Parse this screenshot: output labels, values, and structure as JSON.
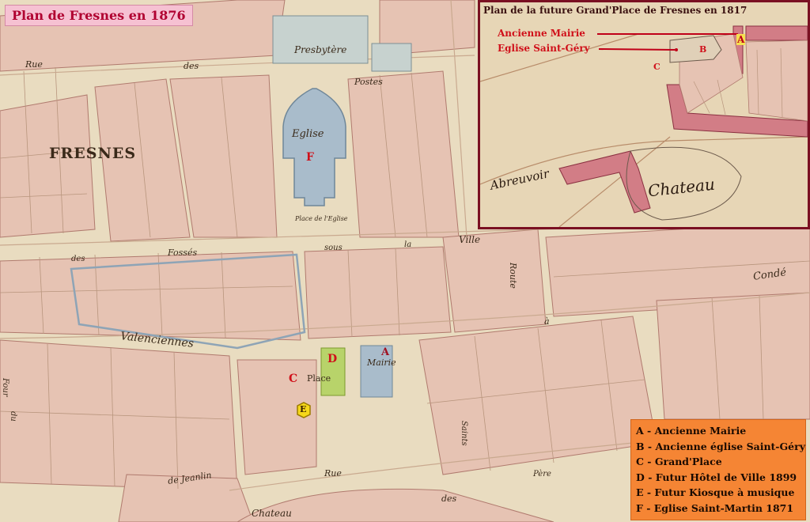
{
  "title": "Plan de Fresnes en 1876",
  "inset": {
    "title": "Plan de la future Grand'Place de Fresnes en 1817",
    "callouts": [
      {
        "text": "Ancienne Mairie",
        "marker": "A"
      },
      {
        "text": "Eglise Saint-Géry",
        "marker": "B"
      }
    ],
    "marker_c": "C",
    "labels": {
      "abreuvoir": "Abreuvoir",
      "chateau": "Chateau"
    }
  },
  "markers": {
    "a": "A",
    "c": "C",
    "d": "D",
    "e": "E",
    "f": "F"
  },
  "map_labels": {
    "fresnes": "FRESNES",
    "presbytere": "Presbytère",
    "eglise": "Eglise",
    "place_eglise": "Place de l'Eglise",
    "rue": "Rue",
    "des": "des",
    "postes": "Postes",
    "fosses": "Fossés",
    "sous": "sous",
    "la": "la",
    "ville": "Ville",
    "route": "Route",
    "a": "à",
    "conde": "Condé",
    "valenciennes": "Valenciennes",
    "place": "Place",
    "mairie": "Mairie",
    "four": "Four",
    "du": "du",
    "de_jeanlin": "de Jeanlin",
    "chateau": "Chateau",
    "rue2": "Rue",
    "des2": "des",
    "saints": "Saints",
    "pere": "Père"
  },
  "legend": [
    "A - Ancienne Mairie",
    "B - Ancienne église Saint-Géry",
    "C - Grand'Place",
    "D - Futur Hôtel de Ville 1899",
    "E - Futur Kiosque à musique",
    "F - Eglise Saint-Martin 1871"
  ],
  "colors": {
    "paper": "#e9dcc0",
    "building": "#e6c3b3",
    "building_edge": "#b07a6e",
    "church_blue": "#a9bccb",
    "hotel_green": "#b8d36a",
    "marker_red": "#d0101a",
    "legend_orange": "#f58534",
    "title_pink": "#f6c1d2",
    "inset_border": "#7a1022",
    "inset_building": "#d27d86"
  }
}
